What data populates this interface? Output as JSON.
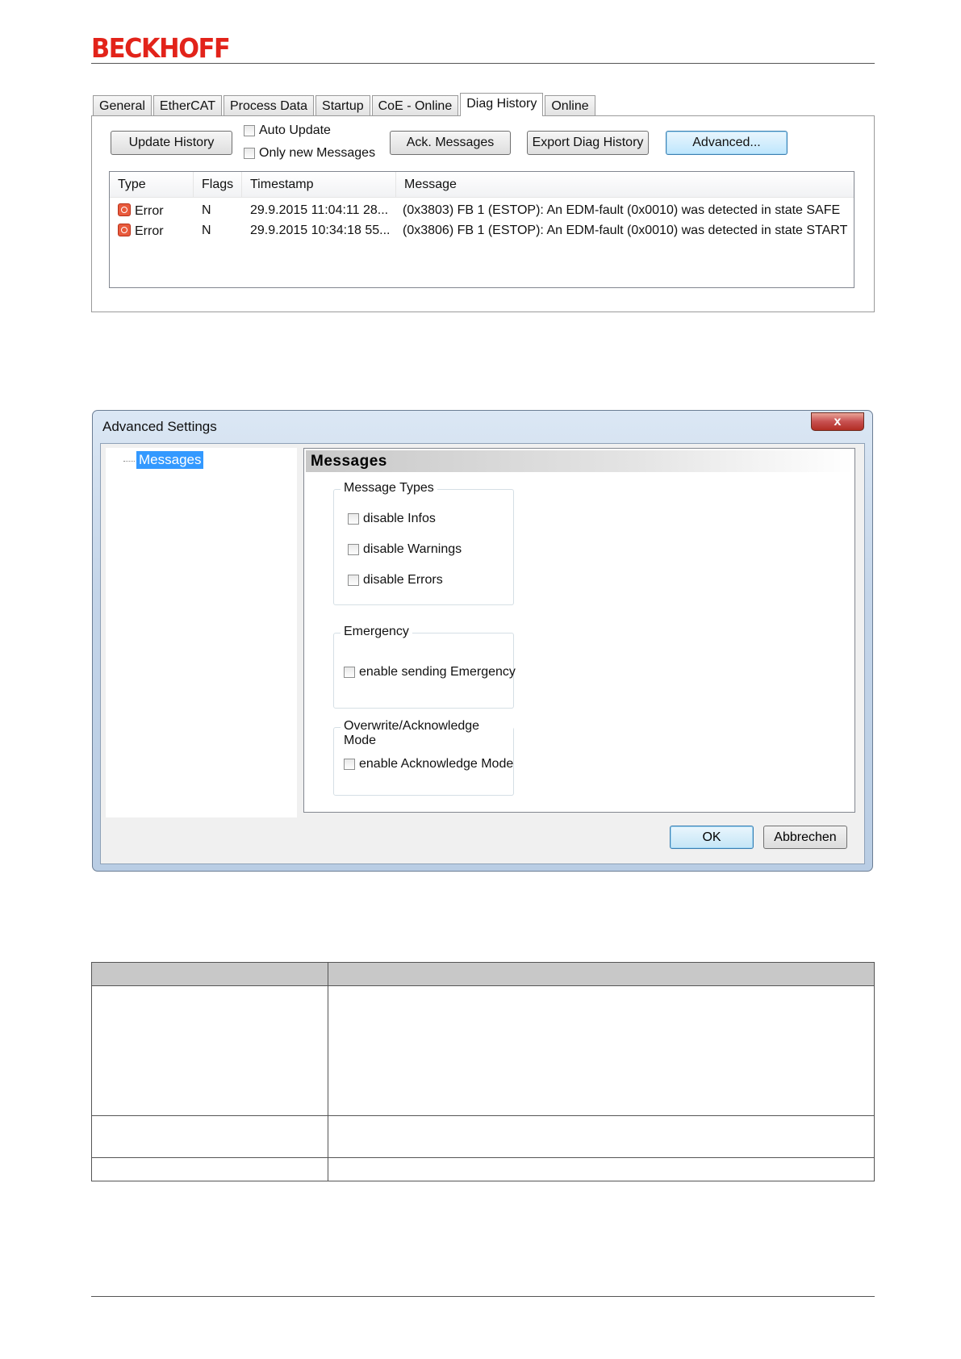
{
  "header": {
    "logo_text": "BECKHOFF"
  },
  "diag_panel": {
    "tabs": [
      {
        "label": "General"
      },
      {
        "label": "EtherCAT"
      },
      {
        "label": "Process Data"
      },
      {
        "label": "Startup"
      },
      {
        "label": "CoE - Online"
      },
      {
        "label": "Diag History",
        "active": true
      },
      {
        "label": "Online"
      }
    ],
    "update_history_label": "Update History",
    "auto_update_label": "Auto Update",
    "only_new_label": "Only new Messages",
    "ack_label": "Ack. Messages",
    "export_label": "Export Diag History",
    "advanced_label": "Advanced...",
    "columns": [
      "Type",
      "Flags",
      "Timestamp",
      "Message"
    ],
    "rows": [
      {
        "type": "Error",
        "flags": "N",
        "timestamp": "29.9.2015 11:04:11 28...",
        "message": "(0x3803) FB 1 (ESTOP): An EDM-fault (0x0010) was detected in state SAFE"
      },
      {
        "type": "Error",
        "flags": "N",
        "timestamp": "29.9.2015 10:34:18 55...",
        "message": "(0x3806) FB 1 (ESTOP): An EDM-fault (0x0010) was detected in state START"
      }
    ]
  },
  "advanced_dialog": {
    "title": "Advanced Settings",
    "close_glyph": "x",
    "tree_item": "Messages",
    "page_title": "Messages",
    "group_types": {
      "label": "Message Types",
      "items": [
        "disable Infos",
        "disable Warnings",
        "disable Errors"
      ]
    },
    "group_emergency": {
      "label": "Emergency",
      "item": "enable sending Emergency"
    },
    "group_ack": {
      "label": "Overwrite/Acknowledge Mode",
      "item": "enable Acknowledge Mode"
    },
    "ok_label": "OK",
    "cancel_label": "Abbrechen"
  },
  "colors": {
    "brand_red": "#e2231a",
    "tree_selection": "#3399ff",
    "error_icon": "#e85a3c",
    "table_header": "#c8c8c8"
  }
}
